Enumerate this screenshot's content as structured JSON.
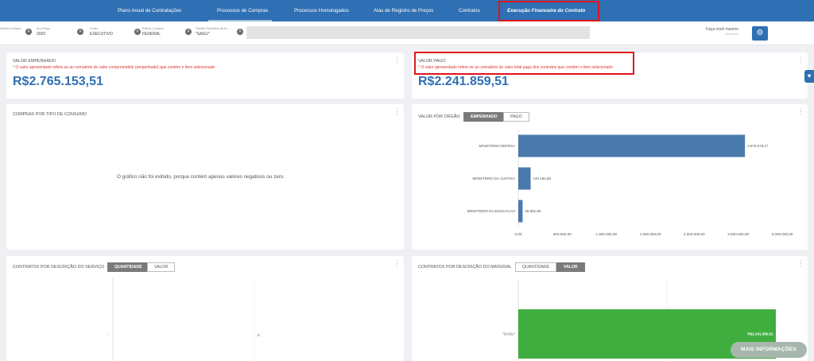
{
  "nav": {
    "items": [
      {
        "label": "Plano Anual de Contratações"
      },
      {
        "label": "Processos de Compras"
      },
      {
        "label": "Processos Homologados"
      },
      {
        "label": "Atas de Registro de Preços"
      },
      {
        "label": "Contratos"
      },
      {
        "label": "Execução Financeira do Contrato"
      }
    ]
  },
  "filters": [
    {
      "label": "Estado Compra",
      "value": ""
    },
    {
      "label": "Ano Pago",
      "value": "2020"
    },
    {
      "label": "Poder",
      "value": "EXECUTIVO"
    },
    {
      "label": "Esfera_Compra",
      "value": "FEDERAL"
    },
    {
      "label": "Padrão Descritivo de M...",
      "value": "\"SAGU\""
    }
  ],
  "selfservice": {
    "title": "Faça você mesmo",
    "subtitle": "Em breve"
  },
  "cards": {
    "empenhado": {
      "title": "VALOR EMPENHADO",
      "note": "* O valor apresentado refere-se ao somatório do valor comprometido (empenhado) que contém o item selecionado",
      "value": "R$2.765.153,51"
    },
    "pago": {
      "title": "VALOR PAGO",
      "note": "* O valor apresentado refere-se ao somatório do valor total pago dos contratos que contém o item selecionado",
      "value": "R$2.241.859,51"
    },
    "consumo": {
      "title": "COMPRAS POR TIPO DE CONSUMO",
      "message": "O gráfico não foi exibido, porque contém apenas valores negativos ou zero."
    },
    "orgao": {
      "title": "VALOR POR ÓRGÃO",
      "toggle_on": "EMPENHADO",
      "toggle_off": "PAGO"
    },
    "servico": {
      "title": "CONTRATOS POR DESCRIÇÃO DO SERVIÇO",
      "toggle_on": "QUANTIDADE",
      "toggle_off": "VALOR"
    },
    "material": {
      "title": "CONTRATOS POR DESCRIÇÃO DO MATERIAL",
      "toggle_on": "VALOR",
      "toggle_off": "QUANTIDADE"
    }
  },
  "more_button": "MAIS INFORMAÇÕES",
  "chart_data": [
    {
      "type": "bar",
      "orientation": "horizontal",
      "categories": [
        "MINISTERIO DEFESA",
        "MINISTERIO DA JUSTICA",
        "MINISTERIO DA EDUCACAO"
      ],
      "values": [
        2576678.17,
        140184.88,
        48891.86
      ],
      "data_labels": [
        "2.576.678,17",
        "140.184,88",
        "48.891,86"
      ],
      "xlim": [
        0,
        3000000
      ],
      "x_ticks": [
        "0,00",
        "500.000,00",
        "1.000.000,00",
        "1.500.000,00",
        "2.000.000,00",
        "2.500.000,00",
        "3.000.000,00"
      ],
      "color": "#4a79ac"
    },
    {
      "type": "bar",
      "orientation": "horizontal",
      "categories": [
        "\"SAGU\""
      ],
      "values": [
        2241859.51
      ],
      "data_labels": [
        "R$2.241.859,51"
      ],
      "color": "#3fae3f"
    },
    {
      "type": "bar",
      "orientation": "vertical",
      "categories": [
        ""
      ],
      "values": [
        0
      ],
      "y_ticks": [
        "0"
      ],
      "color": "#4a79ac"
    }
  ],
  "colors": {
    "nav": "#2f6fb3",
    "accent": "#2f6fb3",
    "highlight": "#e0141e",
    "note": "#e03232"
  },
  "icons": {
    "settings": "sliders-icon",
    "clear": "close-icon",
    "menu": "kebab-icon",
    "sidebar": "heart-icon"
  }
}
